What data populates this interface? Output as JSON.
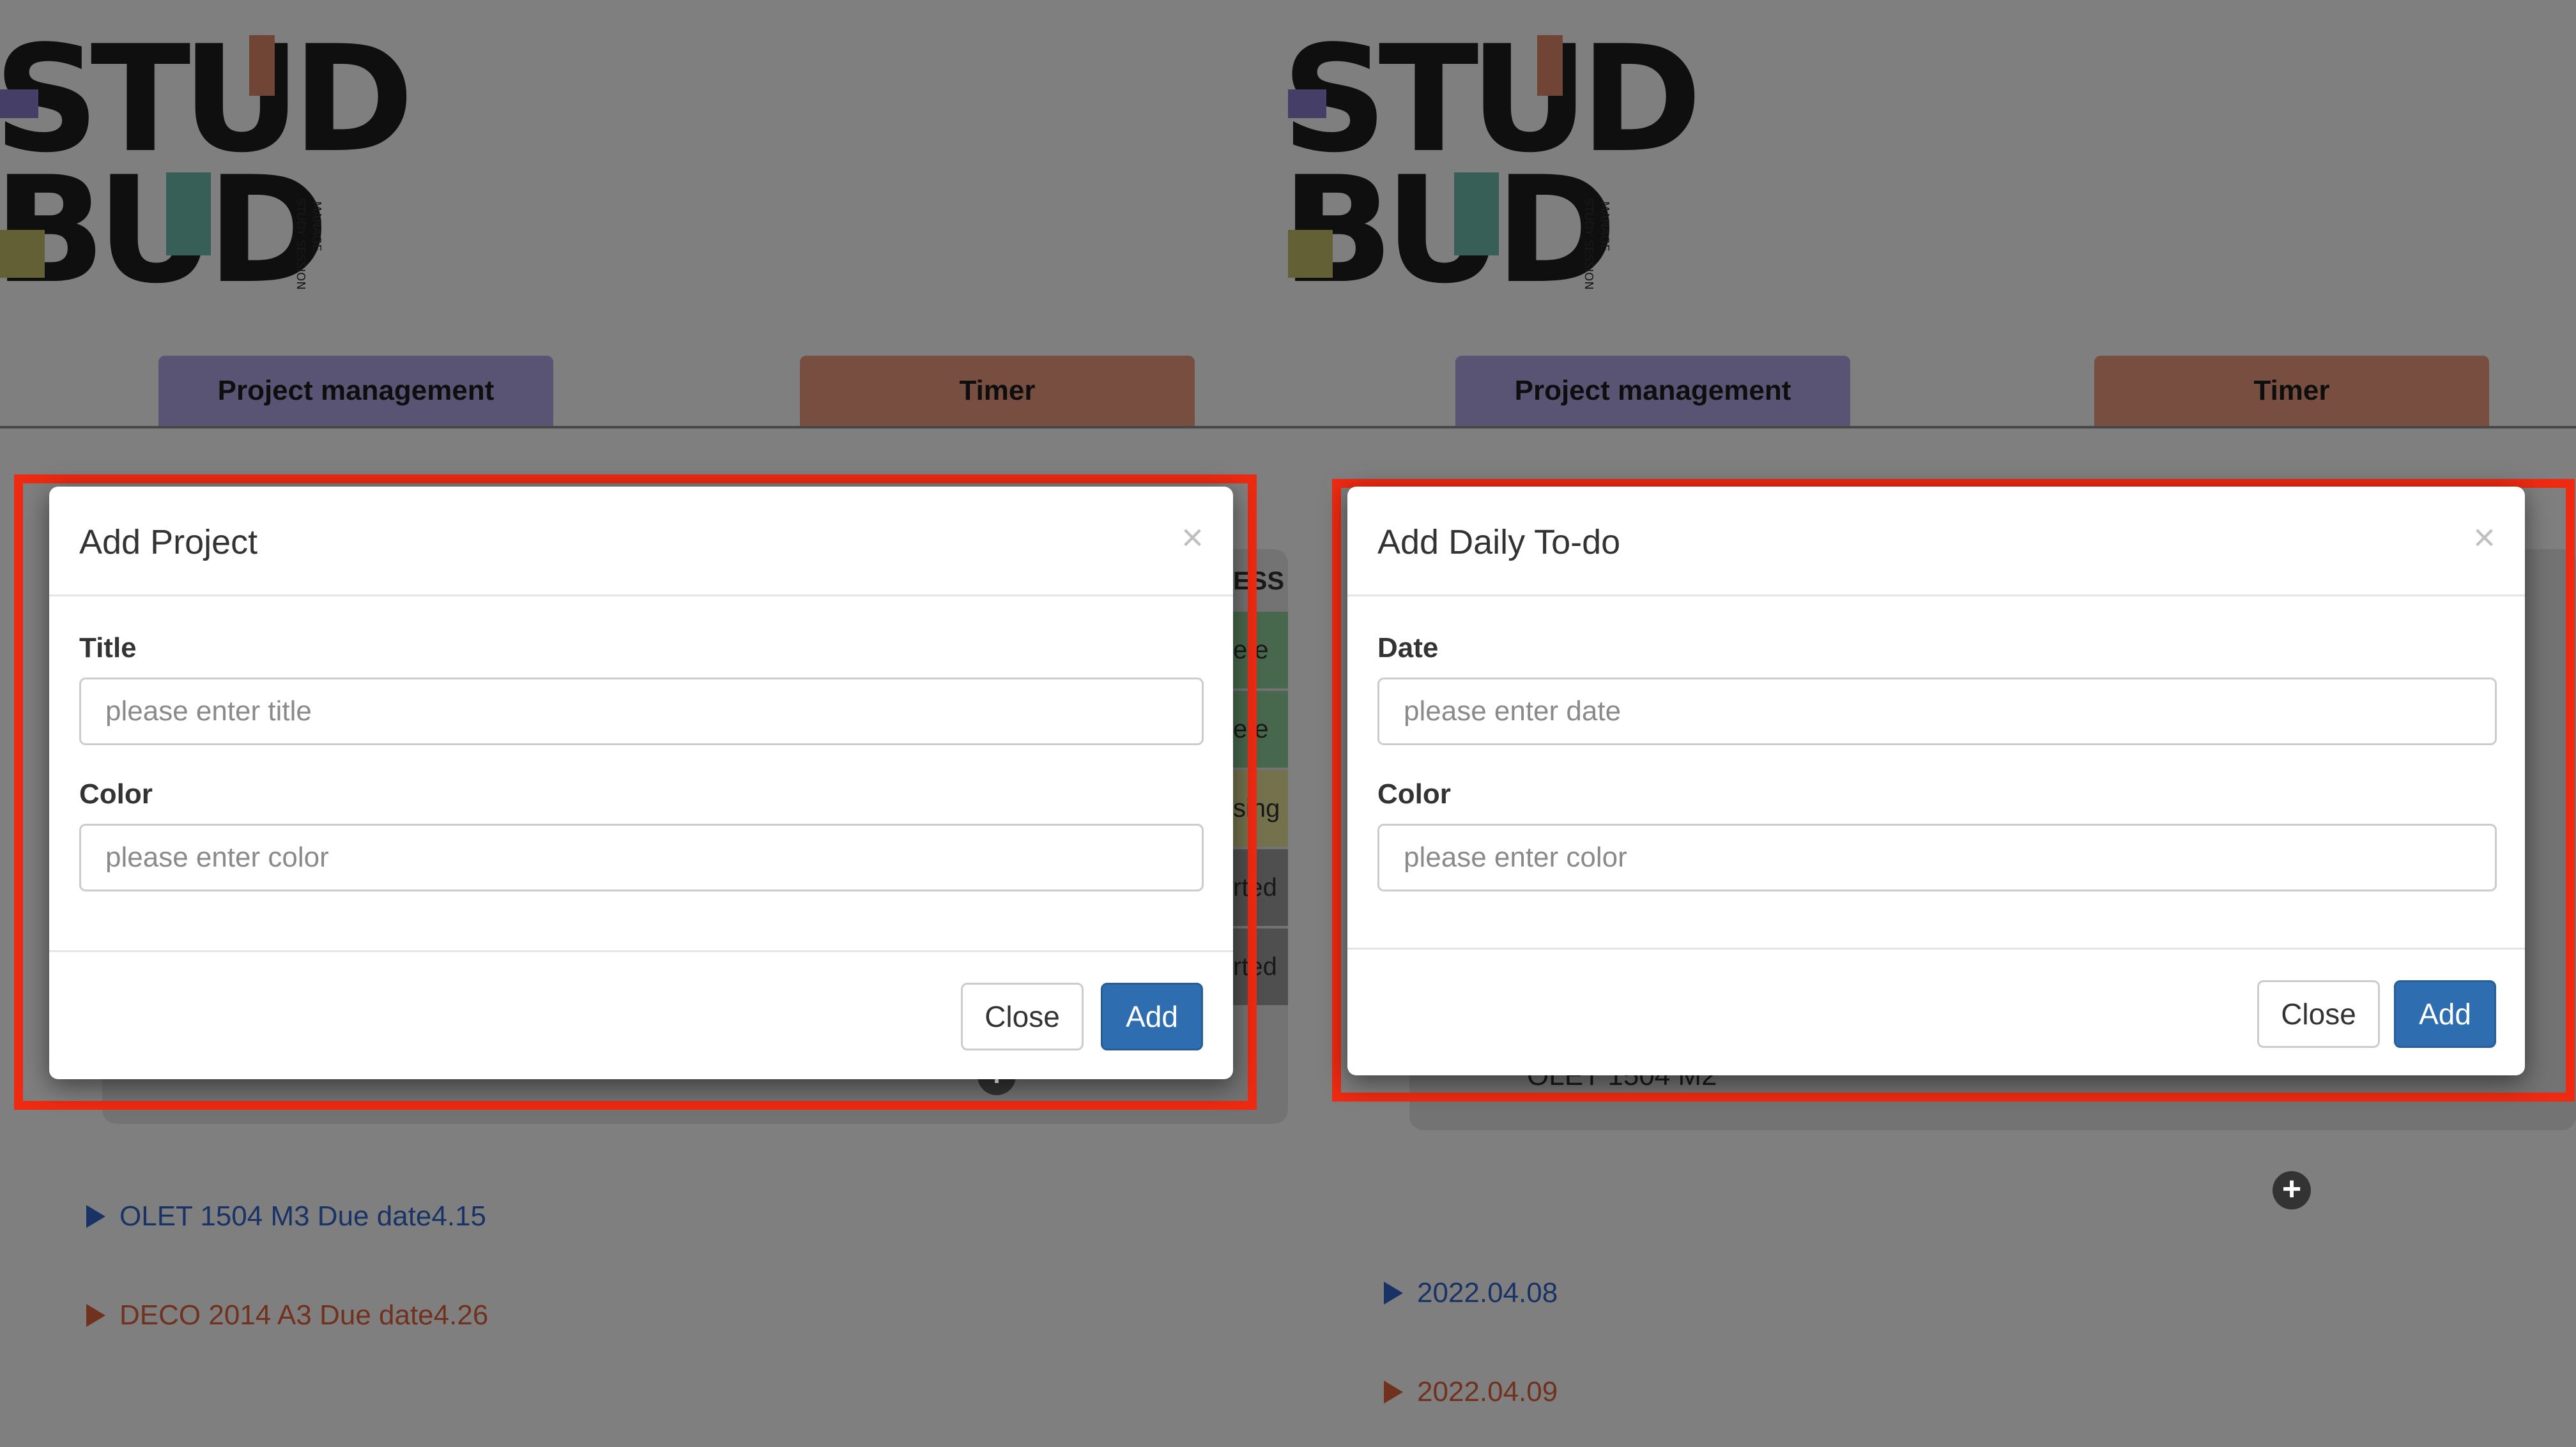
{
  "logo": {
    "word1": "STUD",
    "word2": "BUD",
    "tagline1": "MANAGE",
    "tagline2": "STUDY SESSIONS"
  },
  "tabs": {
    "project_management": "Project management",
    "timer": "Timer"
  },
  "left": {
    "background": {
      "status_header": "ESS",
      "status_items": [
        "ete",
        "ete",
        "sing",
        "rted",
        "rted"
      ],
      "projects": [
        {
          "label": "OLET 1504 M3 Due date4.15",
          "color": "#3366cc"
        },
        {
          "label": "DECO 2014 A3 Due date4.26",
          "color": "#e0643c"
        }
      ]
    },
    "modal": {
      "title": "Add Project",
      "close_symbol": "×",
      "fields": [
        {
          "label": "Title",
          "placeholder": "please enter title",
          "value": ""
        },
        {
          "label": "Color",
          "placeholder": "please enter color",
          "value": ""
        }
      ],
      "close_button": "Close",
      "add_button": "Add"
    }
  },
  "right": {
    "background": {
      "todo_partial": "OLET 1504 M2",
      "dates": [
        {
          "label": "2022.04.08",
          "color": "#3366cc"
        },
        {
          "label": "2022.04.09",
          "color": "#e0643c"
        }
      ]
    },
    "modal": {
      "title": "Add Daily To-do",
      "close_symbol": "×",
      "fields": [
        {
          "label": "Date",
          "placeholder": "please enter date",
          "value": ""
        },
        {
          "label": "Color",
          "placeholder": "please enter color",
          "value": ""
        }
      ],
      "close_button": "Close",
      "add_button": "Add"
    }
  },
  "colors": {
    "highlight": "#ee2a12",
    "tab_pm": "#b3a9e6",
    "tab_timer": "#ef9c7f",
    "add_button": "#2d6db0"
  }
}
